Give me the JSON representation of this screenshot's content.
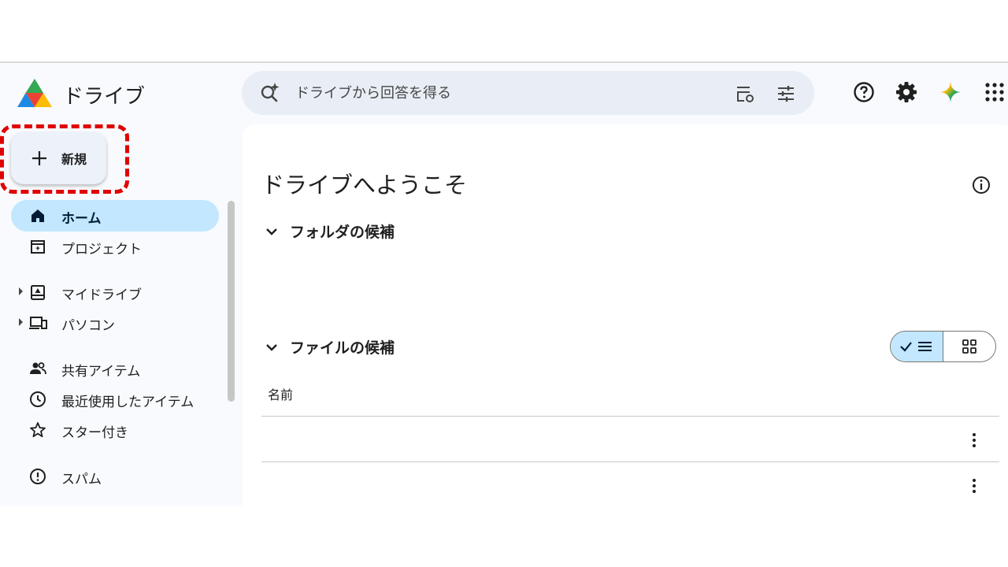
{
  "header": {
    "app_title": "ドライブ",
    "logo_icon": "google-drive-logo",
    "search": {
      "placeholder": "ドライブから回答を得る",
      "value": ""
    }
  },
  "sidebar": {
    "new_label": "新規",
    "items": [
      {
        "label": "ホーム",
        "icon": "home-icon",
        "active": true
      },
      {
        "label": "プロジェクト",
        "icon": "project-icon"
      },
      {
        "label": "マイドライブ",
        "icon": "my-drive-icon",
        "expandable": true
      },
      {
        "label": "パソコン",
        "icon": "computers-icon",
        "expandable": true
      },
      {
        "label": "共有アイテム",
        "icon": "shared-icon"
      },
      {
        "label": "最近使用したアイテム",
        "icon": "clock-icon"
      },
      {
        "label": "スター付き",
        "icon": "star-icon"
      },
      {
        "label": "スパム",
        "icon": "spam-icon"
      }
    ]
  },
  "main": {
    "welcome_title": "ドライブへようこそ",
    "folder_section_title": "フォルダの候補",
    "file_section_title": "ファイルの候補",
    "name_column": "名前",
    "rows": [
      "",
      ""
    ]
  },
  "colors": {
    "accent_active": "#c2e7ff",
    "search_bg": "#e9eef6",
    "highlight_dash": "#e00000"
  }
}
